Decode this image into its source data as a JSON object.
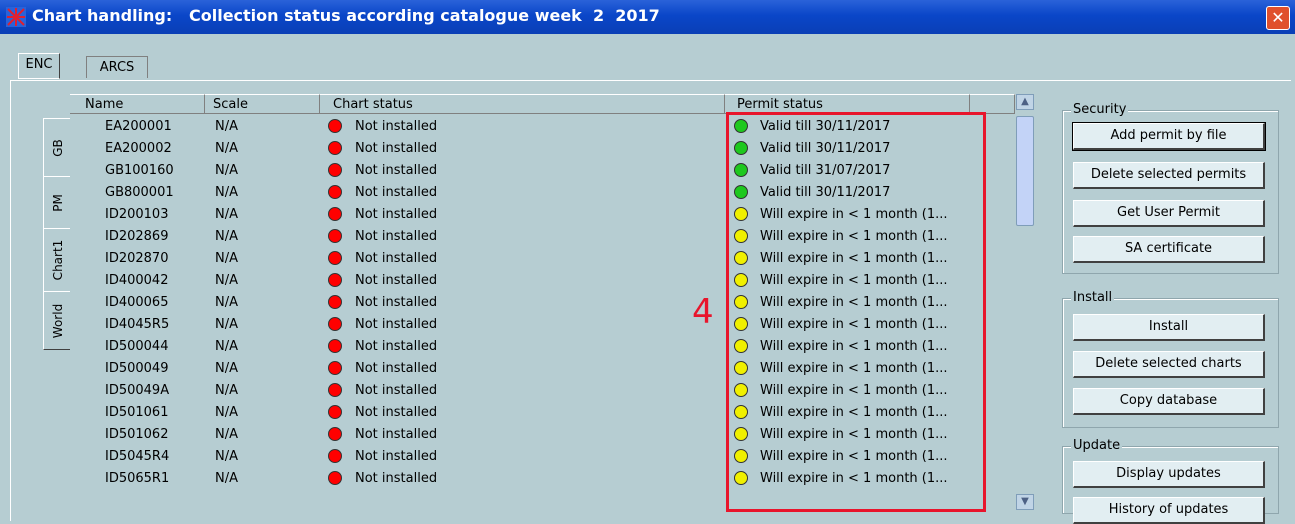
{
  "window": {
    "title": "Chart handling:   Collection status according catalogue week  2  2017",
    "close_label": "✕"
  },
  "tabs": [
    {
      "label": "ENC",
      "active": true
    },
    {
      "label": "ARCS",
      "active": false
    }
  ],
  "side_tabs": [
    "GB",
    "PM",
    "Chart1",
    "World"
  ],
  "table": {
    "columns": [
      "Name",
      "Scale",
      "Chart status",
      "Permit status"
    ],
    "rows": [
      {
        "name": "EA200001",
        "scale": "N/A",
        "chart_status": "Not installed",
        "permit": "Valid till 30/11/2017",
        "permit_color": "green"
      },
      {
        "name": "EA200002",
        "scale": "N/A",
        "chart_status": "Not installed",
        "permit": "Valid till 30/11/2017",
        "permit_color": "green"
      },
      {
        "name": "GB100160",
        "scale": "N/A",
        "chart_status": "Not installed",
        "permit": "Valid till 31/07/2017",
        "permit_color": "green"
      },
      {
        "name": "GB800001",
        "scale": "N/A",
        "chart_status": "Not installed",
        "permit": "Valid till 30/11/2017",
        "permit_color": "green"
      },
      {
        "name": "ID200103",
        "scale": "N/A",
        "chart_status": "Not installed",
        "permit": "Will expire in < 1 month (1...",
        "permit_color": "yellow"
      },
      {
        "name": "ID202869",
        "scale": "N/A",
        "chart_status": "Not installed",
        "permit": "Will expire in < 1 month (1...",
        "permit_color": "yellow"
      },
      {
        "name": "ID202870",
        "scale": "N/A",
        "chart_status": "Not installed",
        "permit": "Will expire in < 1 month (1...",
        "permit_color": "yellow"
      },
      {
        "name": "ID400042",
        "scale": "N/A",
        "chart_status": "Not installed",
        "permit": "Will expire in < 1 month (1...",
        "permit_color": "yellow"
      },
      {
        "name": "ID400065",
        "scale": "N/A",
        "chart_status": "Not installed",
        "permit": "Will expire in < 1 month (1...",
        "permit_color": "yellow"
      },
      {
        "name": "ID4045R5",
        "scale": "N/A",
        "chart_status": "Not installed",
        "permit": "Will expire in < 1 month (1...",
        "permit_color": "yellow"
      },
      {
        "name": "ID500044",
        "scale": "N/A",
        "chart_status": "Not installed",
        "permit": "Will expire in < 1 month (1...",
        "permit_color": "yellow"
      },
      {
        "name": "ID500049",
        "scale": "N/A",
        "chart_status": "Not installed",
        "permit": "Will expire in < 1 month (1...",
        "permit_color": "yellow"
      },
      {
        "name": "ID50049A",
        "scale": "N/A",
        "chart_status": "Not installed",
        "permit": "Will expire in < 1 month (1...",
        "permit_color": "yellow"
      },
      {
        "name": "ID501061",
        "scale": "N/A",
        "chart_status": "Not installed",
        "permit": "Will expire in < 1 month (1...",
        "permit_color": "yellow"
      },
      {
        "name": "ID501062",
        "scale": "N/A",
        "chart_status": "Not installed",
        "permit": "Will expire in < 1 month (1...",
        "permit_color": "yellow"
      },
      {
        "name": "ID5045R4",
        "scale": "N/A",
        "chart_status": "Not installed",
        "permit": "Will expire in < 1 month (1...",
        "permit_color": "yellow"
      },
      {
        "name": "ID5065R1",
        "scale": "N/A",
        "chart_status": "Not installed",
        "permit": "Will expire in < 1 month (1...",
        "permit_color": "yellow"
      }
    ]
  },
  "annotation": "4",
  "groups": {
    "security": {
      "label": "Security",
      "buttons": [
        "Add permit by file",
        "Delete selected permits",
        "Get User Permit",
        "SA certificate"
      ]
    },
    "install": {
      "label": "Install",
      "buttons": [
        "Install",
        "Delete selected charts",
        "Copy database"
      ]
    },
    "update": {
      "label": "Update",
      "buttons": [
        "Display updates",
        "History of updates"
      ]
    }
  },
  "colors": {
    "green": "#1ec81e",
    "yellow": "#f0f000",
    "red": "#ff0000",
    "highlight": "#e8152c"
  }
}
